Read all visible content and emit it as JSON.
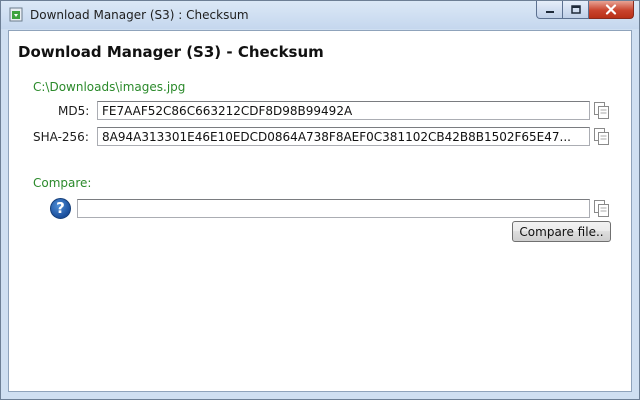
{
  "window": {
    "title": "Download Manager (S3) : Checksum",
    "controls": {
      "minimize": "minimize",
      "maximize": "maximize",
      "close": "close"
    }
  },
  "main": {
    "heading": "Download Manager (S3) - Checksum",
    "file_path": "C:\\Downloads\\images.jpg",
    "md5": {
      "label": "MD5:",
      "value": "FE7AAF52C86C663212CDF8D98B99492A"
    },
    "sha256": {
      "label": "SHA-256:",
      "value": "8A94A313301E46E10EDCD0864A738F8AEF0C381102CB42B8B1502F65E47..."
    },
    "compare": {
      "label": "Compare:",
      "value": "",
      "button_label": "Compare file.."
    }
  },
  "icons": {
    "app": "download-app-icon",
    "copy": "copy-icon",
    "help": "help-question-icon"
  },
  "colors": {
    "accent_green": "#2b8a2b",
    "help_blue": "#1b4f9c",
    "close_red": "#c9442e"
  }
}
